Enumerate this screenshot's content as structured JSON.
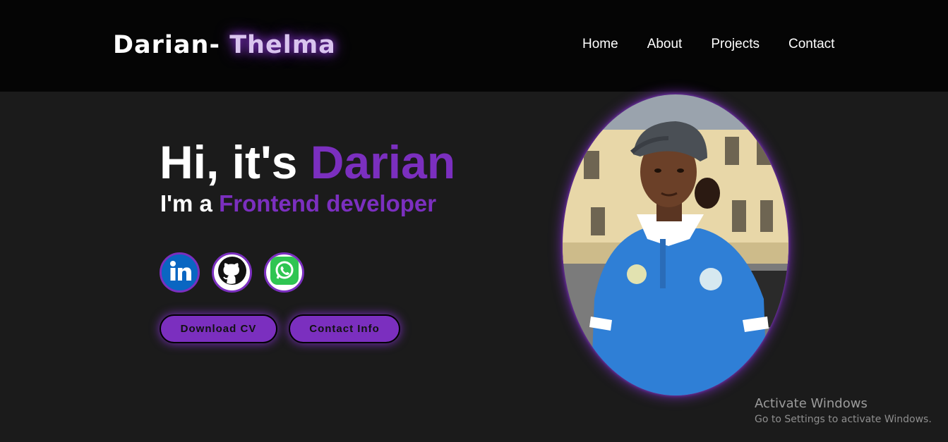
{
  "header": {
    "logo_first": "Darian-",
    "logo_second": "Thelma",
    "nav": [
      {
        "label": "Home"
      },
      {
        "label": "About"
      },
      {
        "label": "Projects"
      },
      {
        "label": "Contact"
      }
    ]
  },
  "hero": {
    "greeting": "Hi, it's",
    "name": "Darian",
    "role_prefix": "I'm a",
    "role": "Frontend developer"
  },
  "socials": [
    {
      "icon": "linkedin-icon"
    },
    {
      "icon": "github-icon"
    },
    {
      "icon": "whatsapp-icon"
    }
  ],
  "buttons": {
    "download_cv": "Download CV",
    "contact_info": "Contact Info"
  },
  "watermark": {
    "title": "Activate Windows",
    "subtitle": "Go to Settings to activate Windows."
  },
  "colors": {
    "accent": "#7b2fbf",
    "background": "#1b1b1b",
    "header": "#050505"
  }
}
